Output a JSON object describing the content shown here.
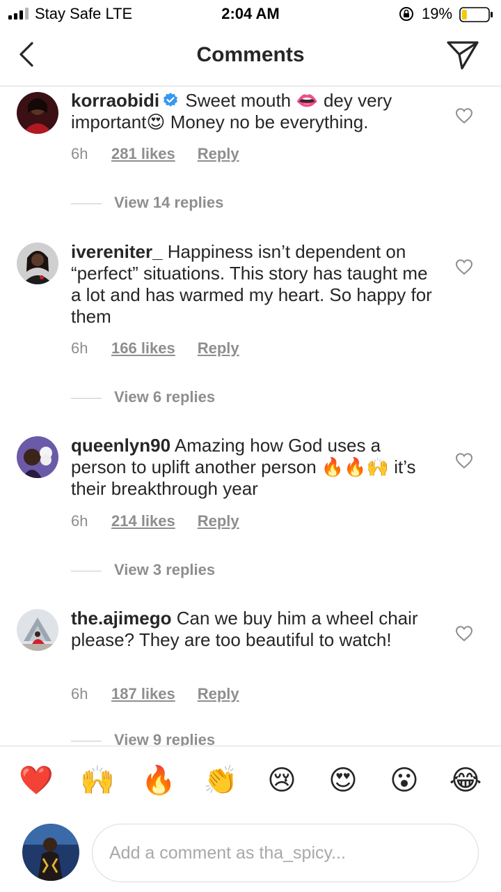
{
  "status_bar": {
    "carrier": "Stay Safe  LTE",
    "time": "2:04 AM",
    "battery_percent": "19%",
    "battery_level": 0.19,
    "battery_color": "#f7c900"
  },
  "header": {
    "title": "Comments",
    "back_icon": "chevron-left-icon",
    "send_icon": "paper-plane-icon"
  },
  "comments": [
    {
      "username": "korraobidi",
      "verified": true,
      "text": "Sweet mouth 👄 dey very important😍 Money no be everything.",
      "age": "6h",
      "likes": "281 likes",
      "reply": "Reply",
      "view_replies": "View 14 replies"
    },
    {
      "username": "ivereniter_",
      "verified": false,
      "text": "Happiness isn’t dependent on “perfect” situations. This story has taught me a lot and has warmed my heart. So happy for them",
      "age": "6h",
      "likes": "166 likes",
      "reply": "Reply",
      "view_replies": "View 6 replies"
    },
    {
      "username": "queenlyn90",
      "verified": false,
      "text": "Amazing how God uses a person to uplift another person 🔥🔥🙌 it’s their breakthrough year",
      "age": "6h",
      "likes": "214 likes",
      "reply": "Reply",
      "view_replies": "View 3 replies"
    },
    {
      "username": "the.ajimego",
      "verified": false,
      "text": "Can we buy him a wheel chair please? They are too beautiful to watch!",
      "age": "6h",
      "likes": "187 likes",
      "reply": "Reply",
      "view_replies": "View 9 replies"
    }
  ],
  "emoji_bar": [
    "❤️",
    "🙌",
    "🔥",
    "👏",
    "😢",
    "😍",
    "😮",
    "😂"
  ],
  "comment_input": {
    "placeholder": "Add a comment as tha_spicy..."
  },
  "colors": {
    "text": "#262626",
    "secondary": "#8e8e8e",
    "verified_blue": "#3897f0",
    "divider": "#dbdbdb"
  }
}
